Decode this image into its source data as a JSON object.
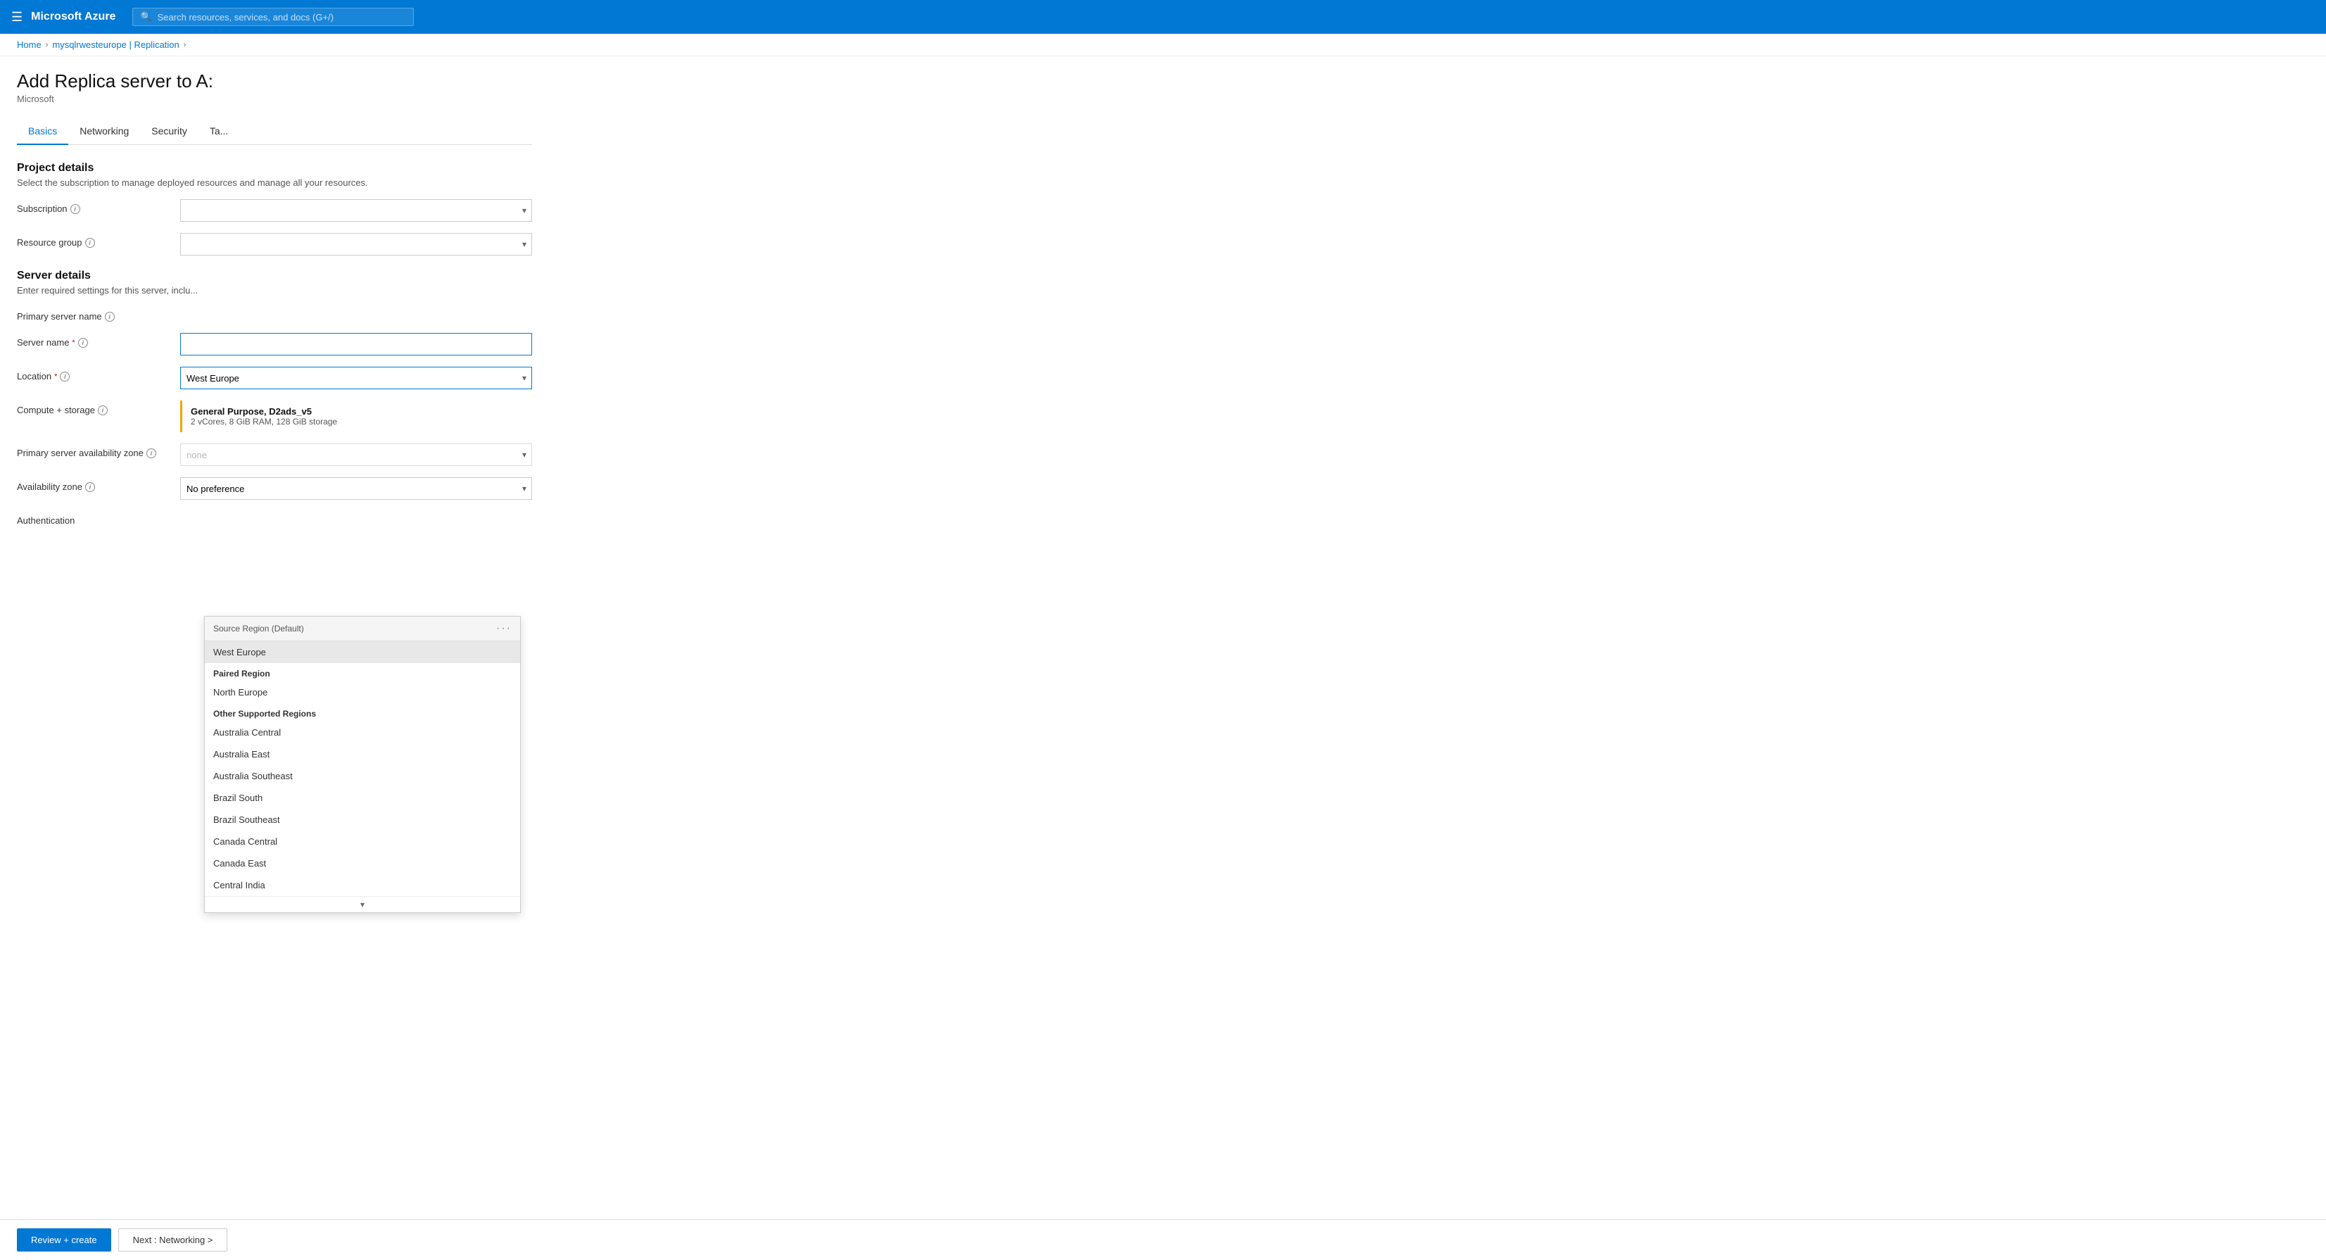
{
  "topNav": {
    "hamburger": "☰",
    "logoText": "Microsoft Azure",
    "searchPlaceholder": "Search resources, services, and docs (G+/)"
  },
  "breadcrumb": {
    "home": "Home",
    "parent": "mysqlrwesteurope | Replication",
    "sep": "›"
  },
  "page": {
    "title": "Add Replica server to A:",
    "subtitle": "Microsoft"
  },
  "tabs": [
    {
      "id": "basics",
      "label": "Basics",
      "active": true
    },
    {
      "id": "networking",
      "label": "Networking",
      "active": false
    },
    {
      "id": "security",
      "label": "Security",
      "active": false
    },
    {
      "id": "tags",
      "label": "Ta...",
      "active": false
    }
  ],
  "sections": {
    "projectDetails": {
      "header": "Project details",
      "desc": "Select the subscription to manage deployed resources and manage all your resources.",
      "subscriptionLabel": "Subscription",
      "resourceGroupLabel": "Resource group"
    },
    "serverDetails": {
      "header": "Server details",
      "desc": "Enter required settings for this server, inclu...",
      "primaryServerNameLabel": "Primary server name",
      "serverNameLabel": "Server name",
      "serverNameRequired": true,
      "serverNameValue": "",
      "locationLabel": "Location",
      "locationRequired": true,
      "locationValue": "West Europe",
      "computeStorageLabel": "Compute + storage",
      "computeTitle": "General Purpose, D2ads_v5",
      "computeDesc": "2 vCores, 8 GiB RAM, 128 GiB storage",
      "primaryAvailZoneLabel": "Primary server availability zone",
      "primaryAvailZoneValue": "none",
      "availZoneLabel": "Availability zone",
      "availZoneRequired": true,
      "availZoneValue": "No preference",
      "authLabel": "Authentication"
    }
  },
  "dropdown": {
    "headerLabel": "Source Region (Default)",
    "dotsLabel": "···",
    "groups": [
      {
        "id": "source",
        "items": [
          {
            "label": "West Europe",
            "selected": true
          }
        ]
      },
      {
        "id": "paired",
        "groupLabel": "Paired Region",
        "items": [
          {
            "label": "North Europe",
            "selected": false
          }
        ]
      },
      {
        "id": "other",
        "groupLabel": "Other Supported Regions",
        "items": [
          {
            "label": "Australia Central",
            "selected": false
          },
          {
            "label": "Australia East",
            "selected": false
          },
          {
            "label": "Australia Southeast",
            "selected": false
          },
          {
            "label": "Brazil South",
            "selected": false
          },
          {
            "label": "Brazil Southeast",
            "selected": false
          },
          {
            "label": "Canada Central",
            "selected": false
          },
          {
            "label": "Canada East",
            "selected": false
          },
          {
            "label": "Central India",
            "selected": false
          }
        ]
      }
    ]
  },
  "buttons": {
    "reviewCreate": "Review + create",
    "nextNetworking": "Next : Networking >"
  }
}
